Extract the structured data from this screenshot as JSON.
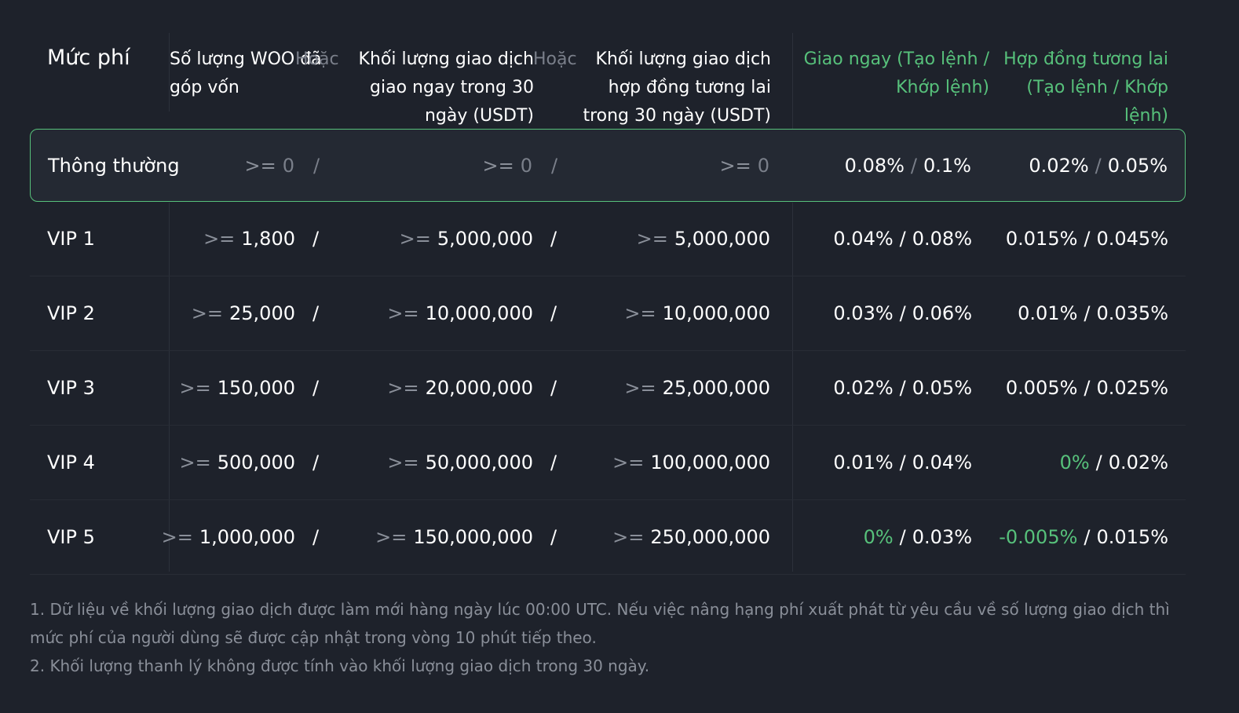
{
  "header": {
    "title": "Mức phí",
    "woo": "Số lượng WOO đã góp vốn",
    "or": "Hoặc",
    "spot": "Khối lượng giao dịch giao ngay trong 30 ngày (USDT)",
    "futures": "Khối lượng giao dịch hợp đồng tương lai trong 30 ngày (USDT)",
    "spot_fee": "Giao ngay (Tạo lệnh / Khớp lệnh)",
    "futures_fee": "Hợp đồng tương lai (Tạo lệnh / Khớp lệnh)"
  },
  "rows": [
    {
      "name": "Thông thường",
      "woo": "0",
      "spot": "0",
      "futures": "0",
      "spot_maker": "0.08%",
      "spot_taker": "0.1%",
      "fut_maker": "0.02%",
      "fut_taker": "0.05%"
    },
    {
      "name": "VIP 1",
      "woo": "1,800",
      "spot": "5,000,000",
      "futures": "5,000,000",
      "spot_maker": "0.04%",
      "spot_taker": "0.08%",
      "fut_maker": "0.015%",
      "fut_taker": "0.045%"
    },
    {
      "name": "VIP 2",
      "woo": "25,000",
      "spot": "10,000,000",
      "futures": "10,000,000",
      "spot_maker": "0.03%",
      "spot_taker": "0.06%",
      "fut_maker": "0.01%",
      "fut_taker": "0.035%"
    },
    {
      "name": "VIP 3",
      "woo": "150,000",
      "spot": "20,000,000",
      "futures": "25,000,000",
      "spot_maker": "0.02%",
      "spot_taker": "0.05%",
      "fut_maker": "0.005%",
      "fut_taker": "0.025%"
    },
    {
      "name": "VIP 4",
      "woo": "500,000",
      "spot": "50,000,000",
      "futures": "100,000,000",
      "spot_maker": "0.01%",
      "spot_taker": "0.04%",
      "fut_maker": "0%",
      "fut_taker": "0.02%"
    },
    {
      "name": "VIP 5",
      "woo": "1,000,000",
      "spot": "150,000,000",
      "futures": "250,000,000",
      "spot_maker": "0%",
      "spot_taker": "0.03%",
      "fut_maker": "-0.005%",
      "fut_taker": "0.015%"
    }
  ],
  "ge": ">=",
  "slash": "/",
  "notes": [
    "1. Dữ liệu về khối lượng giao dịch được làm mới hàng ngày lúc 00:00 UTC. Nếu việc nâng hạng phí xuất phát từ yêu cầu về số lượng giao dịch thì mức phí của người dùng sẽ được cập nhật trong vòng 10 phút tiếp theo.",
    "2. Khối lượng thanh lý không được tính vào khối lượng giao dịch trong 30 ngày."
  ],
  "colors": {
    "background": "#1e222b",
    "accent": "#57c17b",
    "muted": "#7a7f8a"
  }
}
